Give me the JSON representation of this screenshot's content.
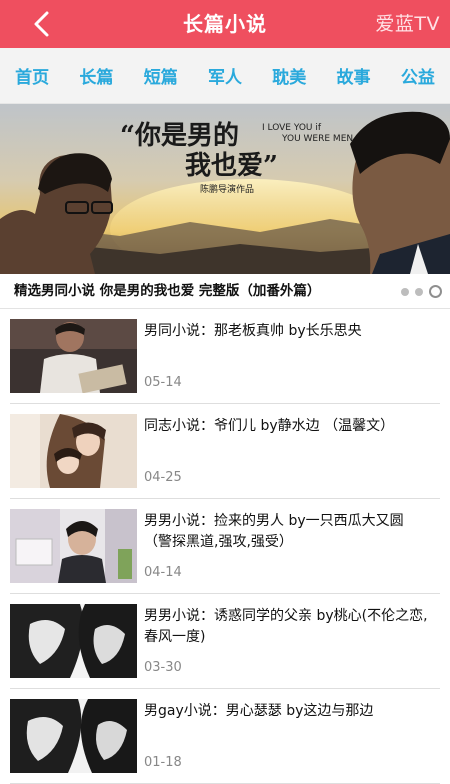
{
  "header": {
    "title": "长篇小说",
    "brand": "爱蓝TV",
    "back_icon": "chevron-left-icon"
  },
  "nav": {
    "items": [
      "首页",
      "长篇",
      "短篇",
      "军人",
      "耽美",
      "故事",
      "公益"
    ]
  },
  "banner": {
    "poster_title": "你是男的我也爱",
    "poster_english_1": "I LOVE YOU if",
    "poster_english_2": "YOU WERE MEN",
    "poster_credit": "陈鹏导演作品",
    "caption": "精选男同小说 你是男的我也爱 完整版（加番外篇）",
    "slide_count": 3,
    "active_slide": 3
  },
  "articles": [
    {
      "title": "男同小说：那老板真帅 by长乐思央",
      "date": "05-14"
    },
    {
      "title": "同志小说：爷们儿 by静水边 （温馨文）",
      "date": "04-25"
    },
    {
      "title": "男男小说：捡来的男人 by一只西瓜大又圆 （警探黑道,强攻,强受）",
      "date": "04-14"
    },
    {
      "title": "男男小说：诱惑同学的父亲 by桃心(不伦之恋,春风一度)",
      "date": "03-30"
    },
    {
      "title": "男gay小说：男心瑟瑟 by这边与那边",
      "date": "01-18"
    }
  ],
  "colors": {
    "header_bg": "#ef4f5f",
    "nav_text": "#2aa9dc",
    "date_text": "#888888"
  }
}
